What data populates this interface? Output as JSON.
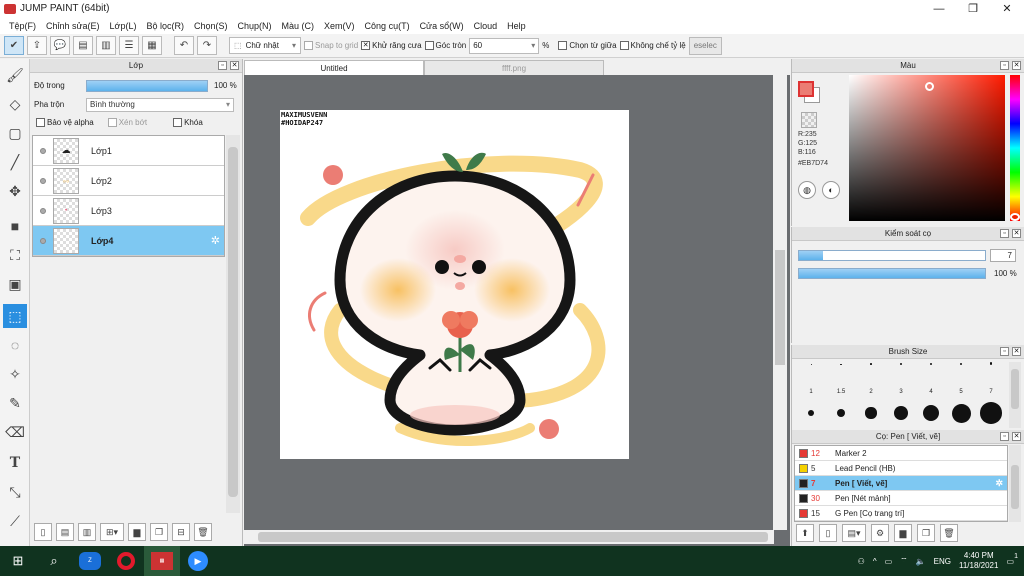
{
  "window": {
    "title": "JUMP PAINT (64bit)",
    "controls": [
      "—",
      "❐",
      "✕"
    ]
  },
  "menu": [
    "Tệp(F)",
    "Chỉnh sửa(E)",
    "Lớp(L)",
    "Bộ lọc(R)",
    "Chọn(S)",
    "Chụp(N)",
    "Màu (C)",
    "Xem(V)",
    "Công cụ(T)",
    "Cửa sổ(W)",
    "Cloud",
    "Help"
  ],
  "toolbar": {
    "shape_select": "Chữ nhật",
    "snap_to_grid": "Snap to grid",
    "anti_alias": "Khử răng cưa",
    "round_corner": "Góc tròn",
    "round_value": "60",
    "percent": "%",
    "select_center": "Chọn từ giữa",
    "no_ratio": "Không chế tỷ lệ",
    "deselect": "eselec"
  },
  "layers_panel": {
    "title": "Lớp",
    "opacity_label": "Độ trong",
    "opacity_value": "100 %",
    "opacity_fraction": 1.0,
    "blend_label": "Pha trộn",
    "blend_value": "Bình thường",
    "protect_alpha": "Bảo vệ alpha",
    "clipping": "Xén bớt",
    "lock": "Khóa",
    "layers": [
      {
        "name": "Lớp1",
        "selected": false
      },
      {
        "name": "Lớp2",
        "selected": false
      },
      {
        "name": "Lớp3",
        "selected": false
      },
      {
        "name": "Lớp4",
        "selected": true
      }
    ]
  },
  "canvas": {
    "tabs": [
      "Untitled",
      "ffff.png"
    ],
    "art_text_line1": "MAXIMUSVENN",
    "art_text_line2": "#HOIDAP247"
  },
  "color_panel": {
    "title": "Màu",
    "r": "R:235",
    "g": "G:125",
    "b": "B:116",
    "hex": "#EB7D74",
    "fg_color": "#eb7d74"
  },
  "brush_control": {
    "title": "Kiểm soát cọ",
    "size_value": "7",
    "size_fraction": 0.13,
    "opacity_value": "100 %",
    "opacity_fraction": 1.0
  },
  "brush_size": {
    "title": "Brush Size",
    "labels": [
      "1",
      "1.5",
      "2",
      "3",
      "4",
      "5",
      "7"
    ]
  },
  "brush_list": {
    "title": "Cọ: Pen [ Viết, vẽ]",
    "items": [
      {
        "num": "12",
        "name": "Marker 2",
        "color": "#e53935",
        "selected": false
      },
      {
        "num": "5",
        "name": "Lead Pencil (HB)",
        "color": "#f5d100",
        "selected": false
      },
      {
        "num": "7",
        "name": "Pen [ Viết, vẽ]",
        "color": "#222222",
        "selected": true
      },
      {
        "num": "30",
        "name": "Pen [Nét mảnh]",
        "color": "#222222",
        "selected": false
      },
      {
        "num": "15",
        "name": "G Pen [Cọ trang trí]",
        "color": "#e53935",
        "selected": false
      }
    ]
  },
  "taskbar": {
    "lang": "ENG",
    "time": "4:40 PM",
    "date": "11/18/2021",
    "notif": "1"
  }
}
